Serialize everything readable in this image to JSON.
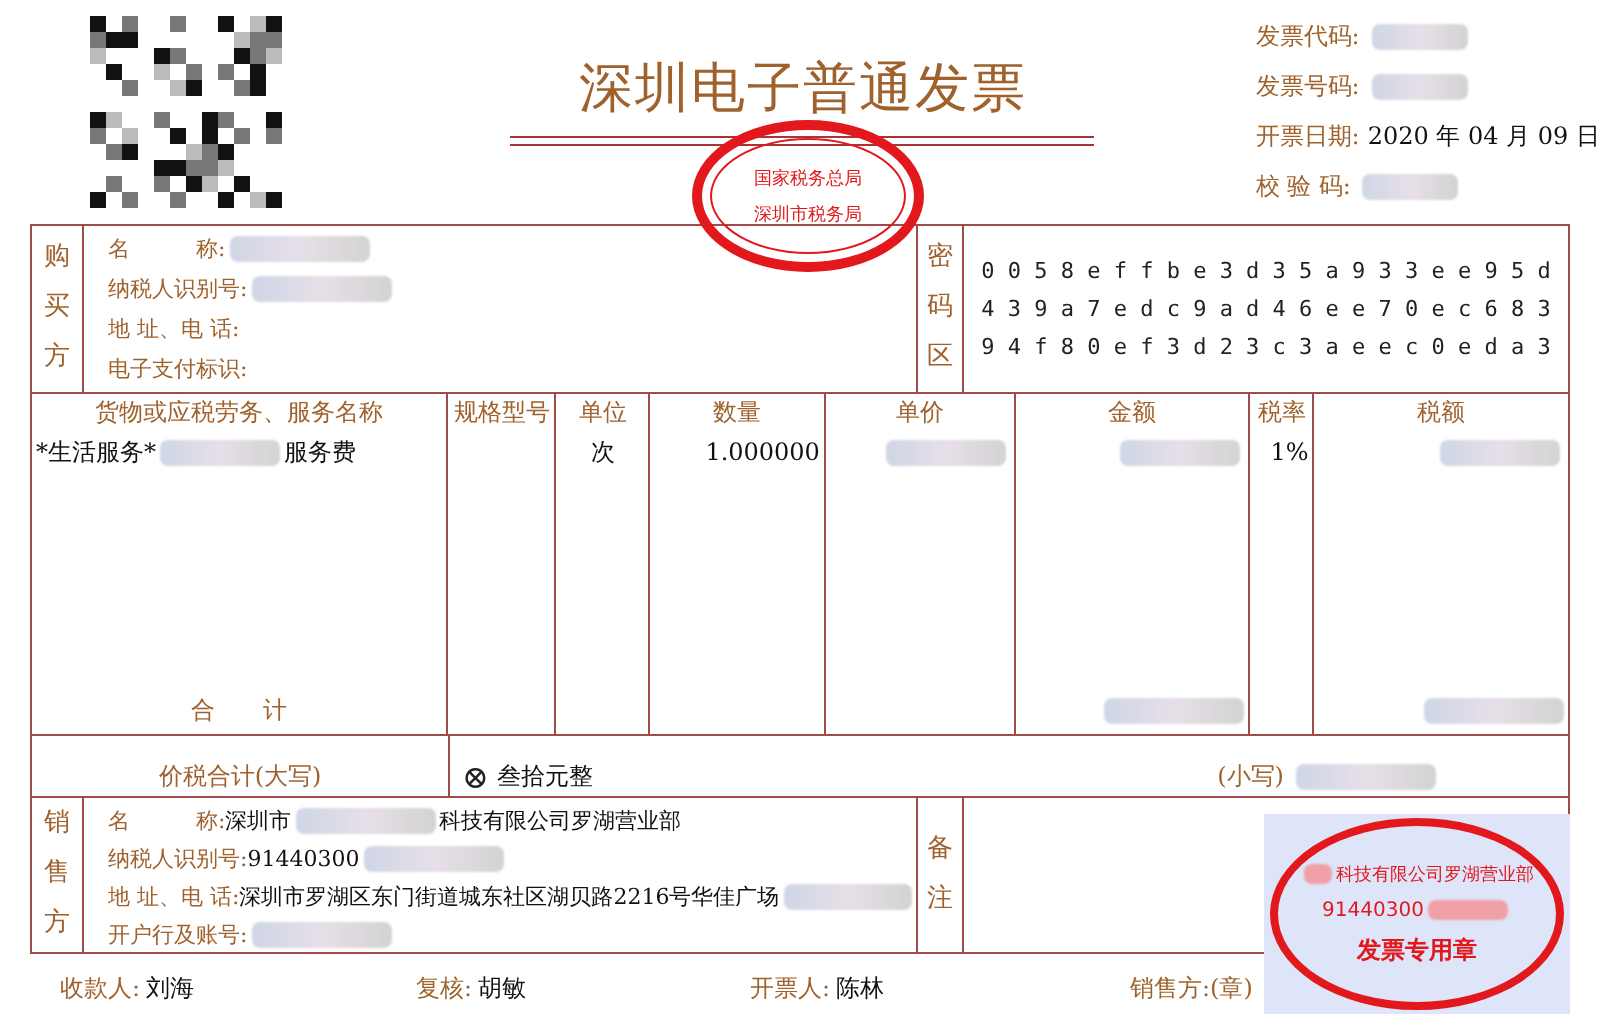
{
  "title": "深圳电子普通发票",
  "official_seal": {
    "lines": [
      "国家税务总局",
      "深圳市税务局"
    ]
  },
  "meta": [
    {
      "label": "发票代码:",
      "kind": "redacted"
    },
    {
      "label": "发票号码:",
      "kind": "redacted"
    },
    {
      "label": "开票日期:",
      "kind": "text",
      "value": "2020 年 04 月 09 日"
    },
    {
      "label": "校 验 码:",
      "kind": "redacted"
    }
  ],
  "buyer": {
    "heading": "购买方",
    "fields": [
      {
        "label": "名　　　称:",
        "parts": [
          {
            "kind": "redacted"
          }
        ]
      },
      {
        "label": "纳税人识别号:",
        "parts": [
          {
            "kind": "redacted"
          }
        ]
      },
      {
        "label": "地 址、电 话:"
      },
      {
        "label": "电子支付标识:"
      }
    ]
  },
  "cipher": {
    "heading": "密码区",
    "lines": [
      "0 0 5 8 e f f b e 3 d 3 5 a 9 3 3 e e 9 5 d",
      "4 3 9 a 7 e d c 9 a d 4 6 e e 7 0 e c 6 8 3",
      "9 4 f 8 0 e f 3 d 2 3 c 3 a e e c 0 e d a 3"
    ]
  },
  "items": {
    "columns": [
      "货物或应税劳务、服务名称",
      "规格型号",
      "单位",
      "数量",
      "单价",
      "金额",
      "税率",
      "税额"
    ],
    "rows": [
      [
        [
          {
            "kind": "text",
            "text": "*生活服务*"
          },
          {
            "kind": "redacted"
          },
          {
            "kind": "text",
            "text": "服务费"
          }
        ],
        [],
        [
          {
            "kind": "text",
            "text": "次"
          }
        ],
        [
          {
            "kind": "text",
            "text": "1.000000"
          }
        ],
        [
          {
            "kind": "redacted"
          }
        ],
        [
          {
            "kind": "redacted"
          }
        ],
        [
          {
            "kind": "text",
            "text": "1%"
          }
        ],
        [
          {
            "kind": "redacted"
          }
        ]
      ]
    ],
    "total": {
      "label": "合　　计",
      "amount": {
        "kind": "redacted"
      },
      "tax": {
        "kind": "redacted"
      }
    }
  },
  "grand_total": {
    "label": "价税合计(大写)",
    "icon": "⊗",
    "words": "叁拾元整",
    "small_label": "(小写)",
    "small_value": {
      "kind": "redacted"
    }
  },
  "seller": {
    "heading": "销售方",
    "fields": [
      {
        "label": "名　　　称:",
        "parts": [
          {
            "kind": "text",
            "text": "深圳市"
          },
          {
            "kind": "redacted"
          },
          {
            "kind": "text",
            "text": "科技有限公司罗湖营业部"
          }
        ]
      },
      {
        "label": "纳税人识别号:",
        "parts": [
          {
            "kind": "text",
            "text": "91440300"
          },
          {
            "kind": "redacted"
          }
        ]
      },
      {
        "label": "地 址、电 话:",
        "parts": [
          {
            "kind": "text",
            "text": "深圳市罗湖区东门街道城东社区湖贝路2216号华佳广场"
          },
          {
            "kind": "redacted"
          }
        ]
      },
      {
        "label": "开户行及账号:",
        "parts": [
          {
            "kind": "redacted"
          }
        ]
      }
    ]
  },
  "notes": {
    "heading": "备注"
  },
  "seller_stamp": {
    "top": "科技有限公司罗湖营业部",
    "number": "91440300",
    "bottom": "发票专用章"
  },
  "footer": [
    {
      "label": "收款人:",
      "value": "刘海"
    },
    {
      "label": "复核:",
      "value": "胡敏"
    },
    {
      "label": "开票人:",
      "value": "陈林"
    },
    {
      "label": "销售方:(章)"
    }
  ]
}
